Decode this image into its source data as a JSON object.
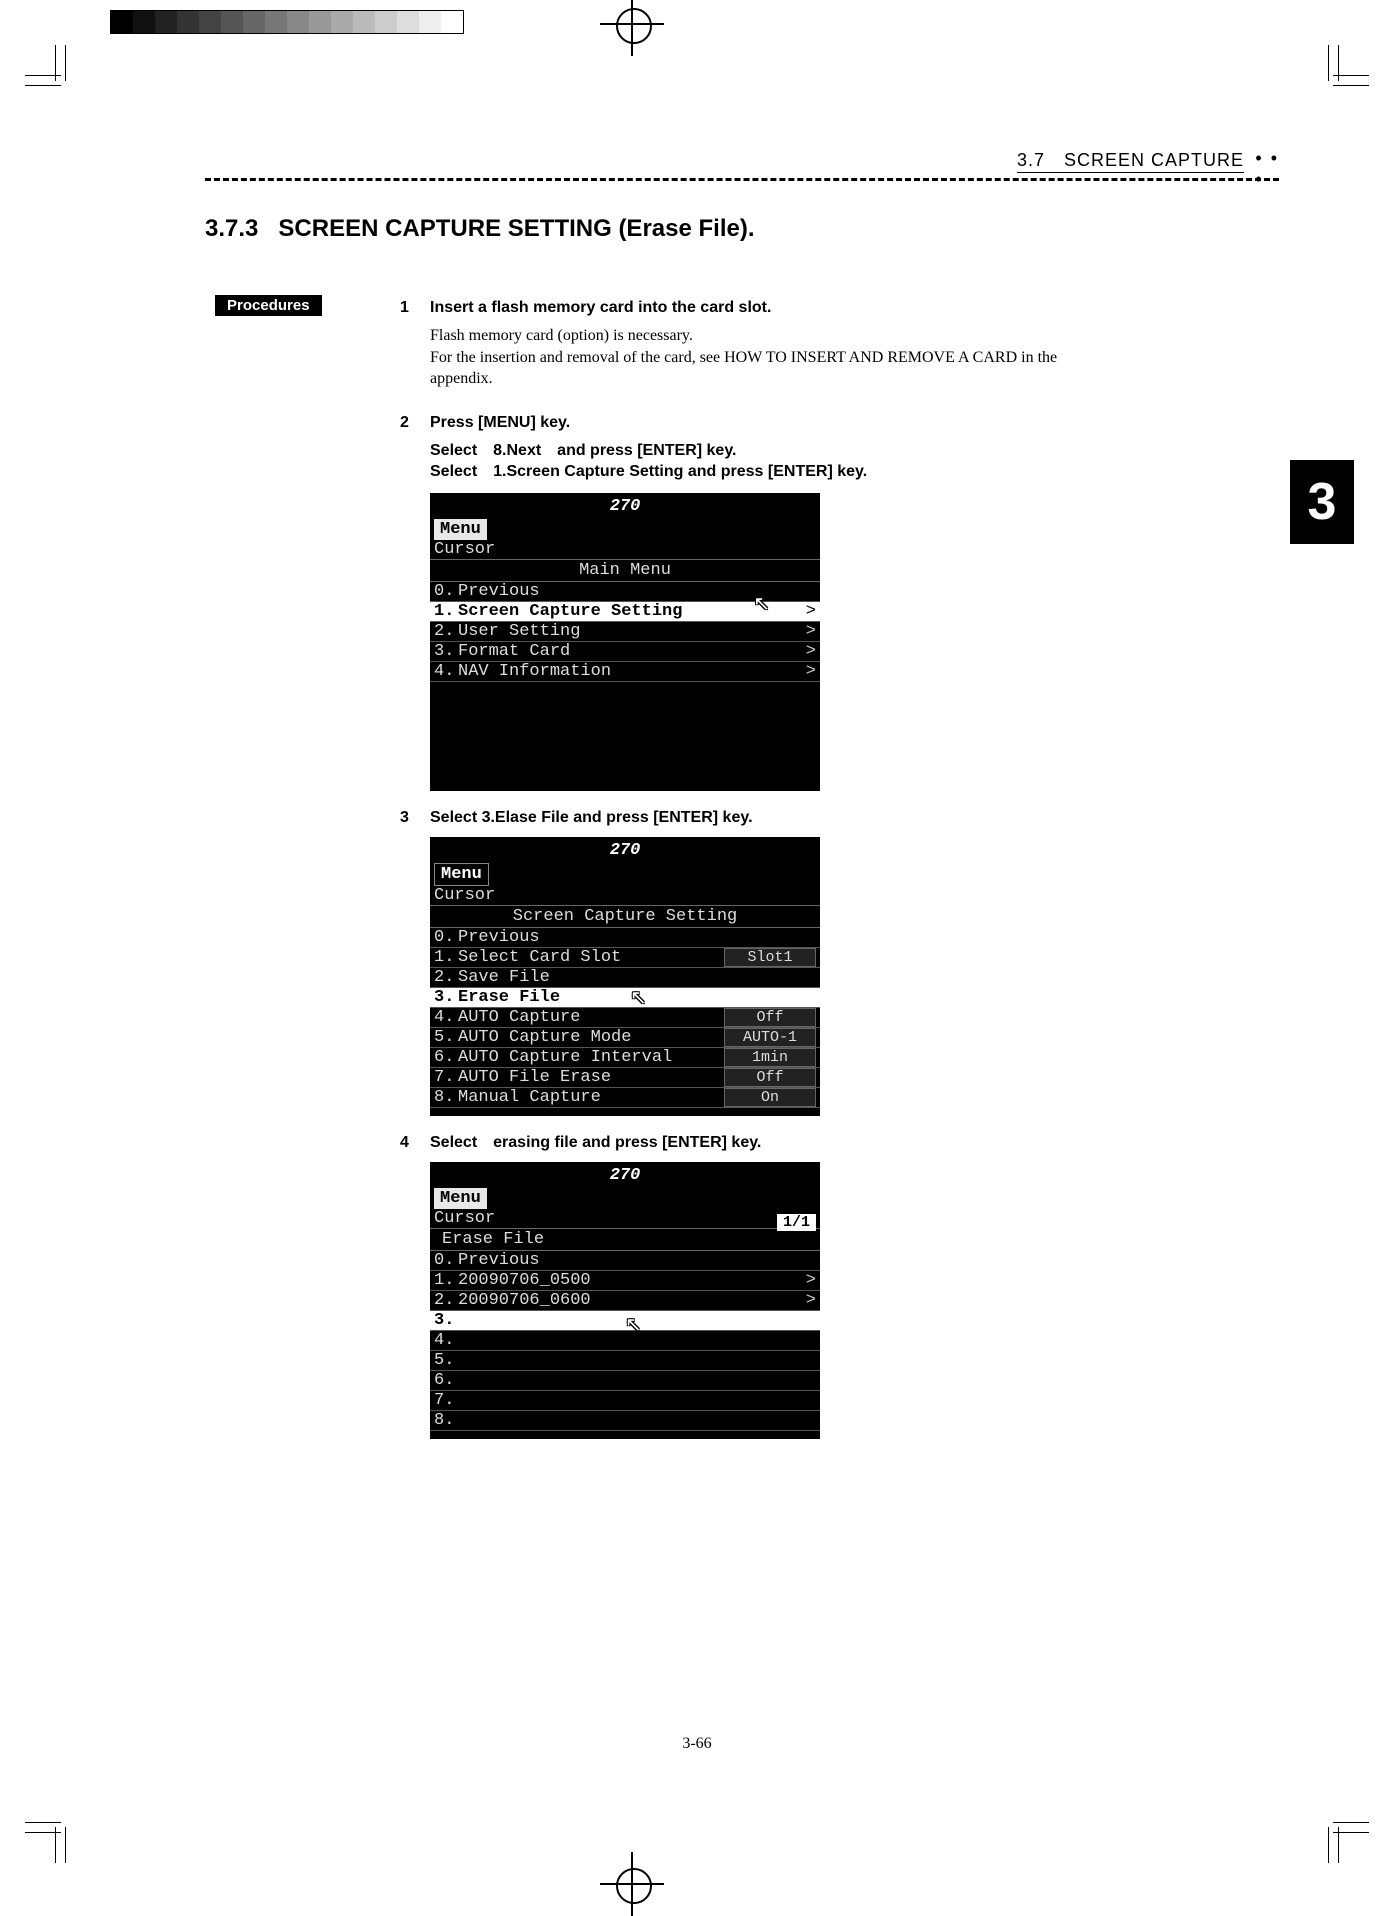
{
  "header": {
    "section_ref": "3.7 SCREEN  CAPTURE"
  },
  "section": {
    "number": "3.7.3",
    "title": "SCREEN CAPTURE SETTING (Erase File)."
  },
  "procedures_label": "Procedures",
  "chapter_tab": "3",
  "steps": [
    {
      "num": "1",
      "label": "Insert a flash memory card into the card slot.",
      "body_lines": [
        "Flash memory card (option) is necessary.",
        "For the insertion and removal of the card, see HOW TO INSERT AND REMOVE A CARD in the appendix."
      ]
    },
    {
      "num": "2",
      "label": "Press [MENU] key.",
      "extra_bold_lines": [
        "Select 8.Next and press [ENTER] key.",
        "Select 1.Screen Capture Setting and press [ENTER] key."
      ]
    },
    {
      "num": "3",
      "label": "Select 3.Elase File and press [ENTER] key."
    },
    {
      "num": "4",
      "label": "Select erasing file and press [ENTER] key."
    }
  ],
  "screen1": {
    "heading": "270",
    "menu": "Menu",
    "cursor": "Cursor",
    "title": "Main Menu",
    "rows": [
      {
        "idx": "0.",
        "txt": "Previous"
      },
      {
        "idx": "1.",
        "txt": "Screen Capture Setting",
        "hi": true,
        "gt": ">"
      },
      {
        "idx": "2.",
        "txt": "User Setting",
        "gt": ">"
      },
      {
        "idx": "3.",
        "txt": "Format Card",
        "gt": ">"
      },
      {
        "idx": "4.",
        "txt": "NAV Information",
        "gt": ">"
      }
    ]
  },
  "screen2": {
    "heading": "270",
    "menu": "Menu",
    "cursor": "Cursor",
    "title": "Screen Capture Setting",
    "rows": [
      {
        "idx": "0.",
        "txt": "Previous"
      },
      {
        "idx": "1.",
        "txt": "Select Card Slot",
        "val": "Slot1"
      },
      {
        "idx": "2.",
        "txt": "Save File"
      },
      {
        "idx": "3.",
        "txt": "Erase File",
        "hi": true
      },
      {
        "idx": "4.",
        "txt": "AUTO Capture",
        "val": "Off"
      },
      {
        "idx": "5.",
        "txt": "AUTO Capture Mode",
        "val": "AUTO-1"
      },
      {
        "idx": "6.",
        "txt": "AUTO Capture Interval",
        "val": "1min"
      },
      {
        "idx": "7.",
        "txt": "AUTO File Erase",
        "val": "Off"
      },
      {
        "idx": "8.",
        "txt": "Manual Capture",
        "val": "On"
      }
    ]
  },
  "screen3": {
    "heading": "270",
    "menu": "Menu",
    "cursor": "Cursor",
    "title": "Erase File",
    "page_indicator": "1/1",
    "rows": [
      {
        "idx": "0.",
        "txt": "Previous"
      },
      {
        "idx": "1.",
        "txt": "20090706_0500",
        "gt": ">"
      },
      {
        "idx": "2.",
        "txt": "20090706_0600",
        "gt": ">"
      },
      {
        "idx": "3.",
        "txt": "",
        "hi": true
      },
      {
        "idx": "4.",
        "txt": ""
      },
      {
        "idx": "5.",
        "txt": ""
      },
      {
        "idx": "6.",
        "txt": ""
      },
      {
        "idx": "7.",
        "txt": ""
      },
      {
        "idx": "8.",
        "txt": ""
      }
    ]
  },
  "footer_page": "3-66"
}
